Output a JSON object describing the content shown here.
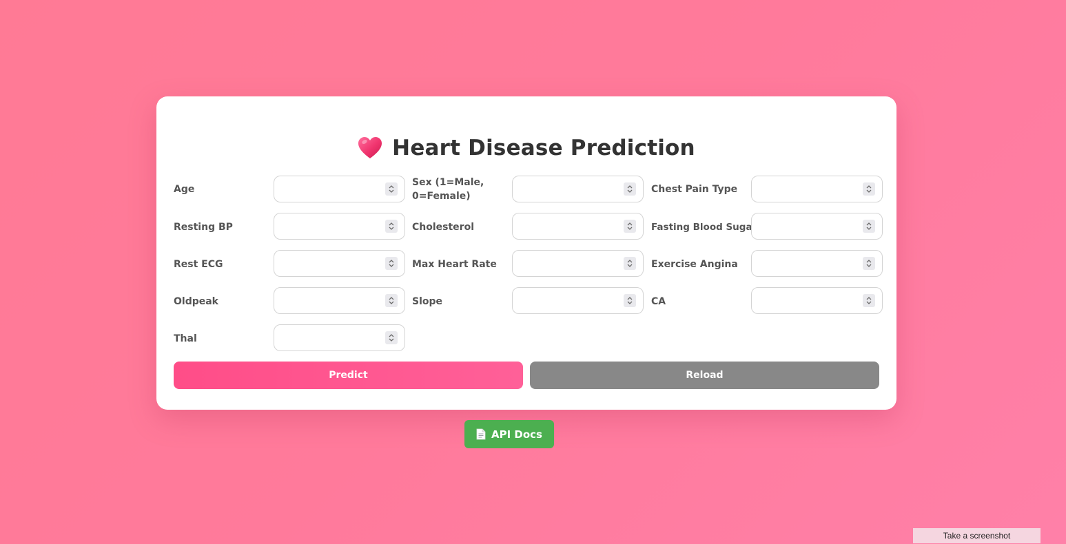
{
  "title": "Heart Disease Prediction",
  "colors": {
    "background": "#ff7a95",
    "predict": "#ff4d88",
    "reload": "#888888",
    "api_docs": "#4caf50",
    "title_text": "#333333"
  },
  "icons": {
    "title": "heart-icon",
    "api_docs": "document-icon"
  },
  "form": {
    "fields": [
      {
        "label": "Age",
        "value": ""
      },
      {
        "label": "Sex (1=Male, 0=Female)",
        "value": ""
      },
      {
        "label": "Chest Pain Type",
        "value": ""
      },
      {
        "label": "Resting BP",
        "value": ""
      },
      {
        "label": "Cholesterol",
        "value": ""
      },
      {
        "label": "Fasting Blood Sugar",
        "value": ""
      },
      {
        "label": "Rest ECG",
        "value": ""
      },
      {
        "label": "Max Heart Rate",
        "value": ""
      },
      {
        "label": "Exercise Angina",
        "value": ""
      },
      {
        "label": "Oldpeak",
        "value": ""
      },
      {
        "label": "Slope",
        "value": ""
      },
      {
        "label": "CA",
        "value": ""
      },
      {
        "label": "Thal",
        "value": ""
      }
    ]
  },
  "buttons": {
    "predict": "Predict",
    "reload": "Reload"
  },
  "api_docs": {
    "label": "API Docs"
  },
  "overlay": {
    "screenshot_label": "Take a screenshot"
  }
}
